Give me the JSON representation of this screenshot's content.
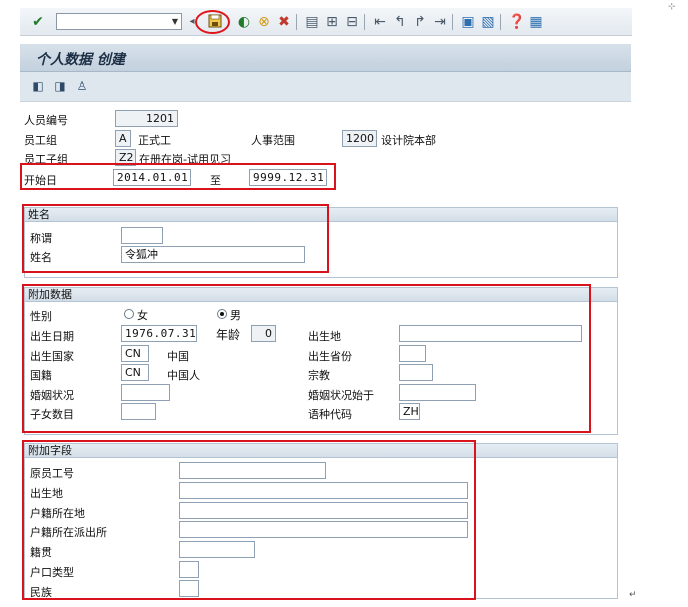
{
  "toolbar": {
    "command_field_value": "",
    "icons": [
      "enter-icon",
      "save-icon",
      "back-icon",
      "exit-icon",
      "cancel-icon",
      "print-icon",
      "find-icon",
      "find-next-icon",
      "first-page-icon",
      "prev-page-icon",
      "next-page-icon",
      "last-page-icon",
      "create-session-icon",
      "shortcut-icon",
      "help-icon",
      "layout-icon"
    ]
  },
  "title": "个人数据 创建",
  "app_toolbar_icons": [
    "previous-record-icon",
    "next-record-icon",
    "person-icon"
  ],
  "header": {
    "personnel_number_label": "人员编号",
    "personnel_number": "1201",
    "employee_group_label": "员工组",
    "employee_group_code": "A",
    "employee_group_text": "正式工",
    "personnel_area_label": "人事范围",
    "personnel_area_code": "1200",
    "personnel_area_text": "设计院本部",
    "employee_subgroup_label": "员工子组",
    "employee_subgroup_code": "Z2",
    "employee_subgroup_text": "在册在岗-试用见习",
    "start_label": "开始日",
    "start_date": "2014.01.01",
    "to_label": "至",
    "end_date": "9999.12.31"
  },
  "name_group": {
    "title": "姓名",
    "salutation_label": "称谓",
    "salutation": "",
    "name_label": "姓名",
    "name": "令狐冲"
  },
  "extra_group": {
    "title": "附加数据",
    "gender_label": "性别",
    "female_label": "女",
    "male_label": "男",
    "gender_selected": "男",
    "birth_date_label": "出生日期",
    "birth_date": "1976.07.31",
    "age_label": "年龄",
    "age": "0",
    "birthplace_label": "出生地",
    "birthplace": "",
    "birth_country_label": "出生国家",
    "birth_country_code": "CN",
    "birth_country_text": "中国",
    "birth_province_label": "出生省份",
    "birth_province": "",
    "nationality_label": "国籍",
    "nationality_code": "CN",
    "nationality_text": "中国人",
    "religion_label": "宗教",
    "religion": "",
    "marital_label": "婚姻状况",
    "marital": "",
    "marital_since_label": "婚姻状况始于",
    "marital_since": "",
    "children_label": "子女数目",
    "children": "",
    "language_label": "语种代码",
    "language": "ZH"
  },
  "custom_group": {
    "title": "附加字段",
    "orig_emp_no_label": "原员工号",
    "orig_emp_no": "",
    "birthplace_label": "出生地",
    "birthplace": "",
    "hukou_location_label": "户籍所在地",
    "hukou_location": "",
    "hukou_police_label": "户籍所在派出所",
    "hukou_police": "",
    "native_place_label": "籍贯",
    "native_place": "",
    "hukou_type_label": "户口类型",
    "hukou_type": "",
    "ethnicity_label": "民族",
    "ethnicity": ""
  },
  "colors": {
    "highlight": "#d8131b",
    "title_bg": "#c3d1de",
    "group_border": "#b5c4d2"
  }
}
